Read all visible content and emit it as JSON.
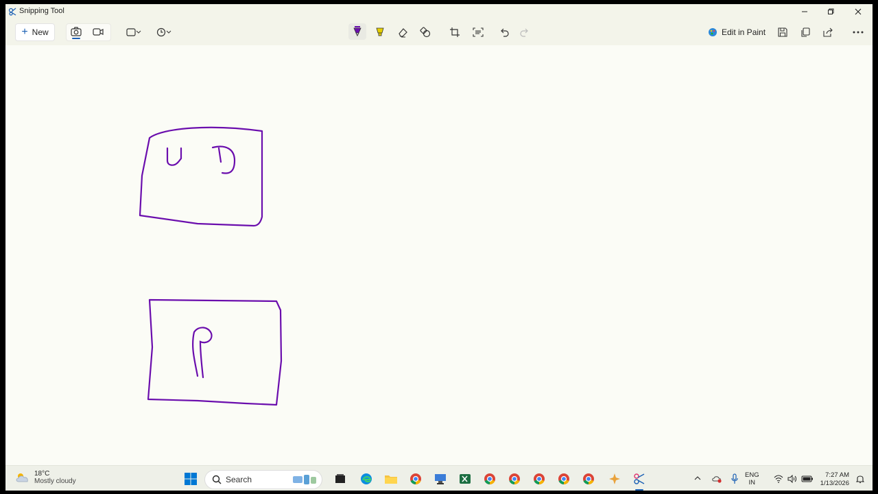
{
  "window": {
    "title": "Snipping Tool",
    "minimize_icon": "minimize-icon",
    "maximize_icon": "restore-icon",
    "close_icon": "close-icon"
  },
  "toolbar": {
    "new_label": "New",
    "edit_in_paint_label": "Edit in Paint",
    "accent_color": "#1a5fb4",
    "pen_color": "#6a0dad"
  },
  "taskbar": {
    "weather_temp": "18°C",
    "weather_desc": "Mostly cloudy",
    "search_placeholder": "Search",
    "language_line1": "ENG",
    "language_line2": "IN",
    "time": "7:27 AM",
    "date": "1/13/2026"
  },
  "drawing": {
    "box1_letters": [
      "U",
      "D"
    ],
    "box2_letters": [
      "P"
    ]
  }
}
